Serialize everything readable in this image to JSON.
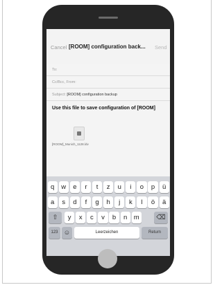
{
  "mail": {
    "cancel_label": "Cancel",
    "subject_title": "[ROOM] configuration back...",
    "send_label": "Send",
    "to_label": "To:",
    "cc_label": "Cc/Bcc, From:",
    "subject_label": "Subject:",
    "subject_value": "[ROOM] configuration backup",
    "body": "Use this file to save configuration of [ROOM]",
    "attachment_name": "[ROOM]_Munich_1128.ldv"
  },
  "keyboard": {
    "row1": [
      "q",
      "w",
      "e",
      "r",
      "t",
      "z",
      "u",
      "i",
      "o",
      "p",
      "ü"
    ],
    "row2": [
      "a",
      "s",
      "d",
      "f",
      "g",
      "h",
      "j",
      "k",
      "l",
      "ö",
      "ä"
    ],
    "row3": [
      "y",
      "x",
      "c",
      "v",
      "b",
      "n",
      "m"
    ],
    "shift": "⇧",
    "backspace": "⌫",
    "numbers": "123",
    "emoji": "☺",
    "space": "Leerzeichen",
    "return": "Return"
  },
  "colors": {
    "phone_body": "#262626",
    "keyboard_bg": "#d3d5da",
    "key_bg": "#ffffff",
    "special_key_bg": "#b3b7bf"
  }
}
